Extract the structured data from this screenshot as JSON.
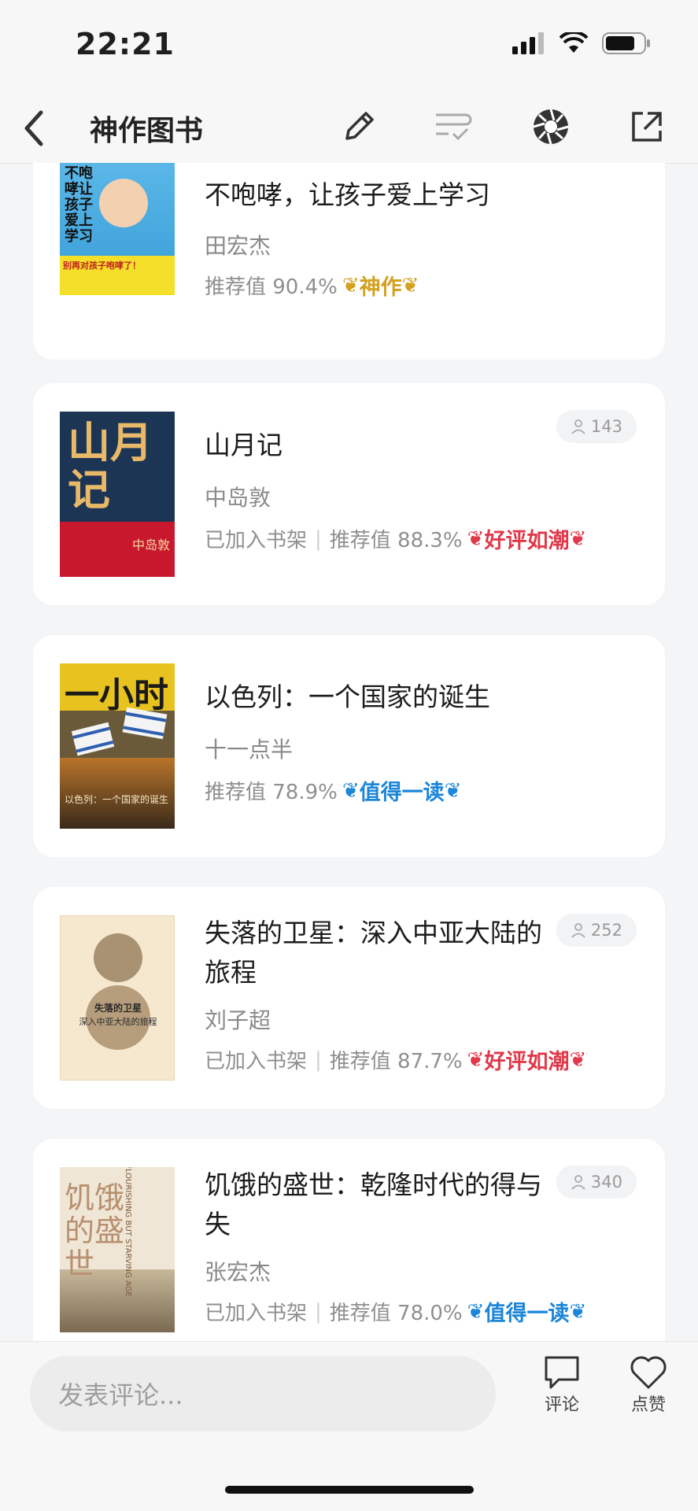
{
  "status_bar": {
    "time": "22:21"
  },
  "nav": {
    "title": "神作图书"
  },
  "books": [
    {
      "title": "不咆哮，让孩子爱上学习",
      "author": "田宏杰",
      "shelf": "",
      "recommend": "推荐值 90.4%",
      "badge": "神作",
      "badge_color": "#d4a020",
      "count": "",
      "cover_text": "不咆哮让孩子爱上学习",
      "cover_sub": "别再对孩子咆哮了！"
    },
    {
      "title": "山月记",
      "author": "中岛敦",
      "shelf": "已加入书架",
      "recommend": "推荐值 88.3%",
      "badge": "好评如潮",
      "badge_color": "#e0394a",
      "count": "143",
      "cover_text": "山月记",
      "cover_sub": "中岛敦"
    },
    {
      "title": "以色列：一个国家的诞生",
      "author": "十一点半",
      "shelf": "",
      "recommend": "推荐值 78.9%",
      "badge": "值得一读",
      "badge_color": "#1c86d8",
      "count": "",
      "cover_text": "一小时",
      "cover_sub": "以色列：一个国家的诞生"
    },
    {
      "title": "失落的卫星：深入中亚大陆的旅程",
      "author": "刘子超",
      "shelf": "已加入书架",
      "recommend": "推荐值 87.7%",
      "badge": "好评如潮",
      "badge_color": "#e0394a",
      "count": "252",
      "cover_text": "失落的卫星",
      "cover_sub": "深入中亚大陆的旅程"
    },
    {
      "title": "饥饿的盛世：乾隆时代的得与失",
      "author": "张宏杰",
      "shelf": "已加入书架",
      "recommend": "推荐值 78.0%",
      "badge": "值得一读",
      "badge_color": "#1c86d8",
      "count": "340",
      "cover_text": "饥饿的盛世",
      "cover_sub": "A FLOURISHING BUT STARVING AGE"
    }
  ],
  "bottom": {
    "comment_placeholder": "发表评论...",
    "comment_label": "评论",
    "like_label": "点赞"
  }
}
